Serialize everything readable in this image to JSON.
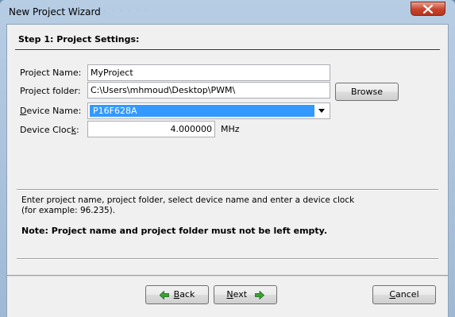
{
  "window": {
    "title": "New Project Wizard",
    "accent": "#c7432a"
  },
  "step": {
    "header": "Step 1: Project Settings:"
  },
  "form": {
    "project_name_label": "Project Name:",
    "project_name_value": "MyProject",
    "project_folder_label": "Project folder:",
    "project_folder_value": "C:\\Users\\mhmoud\\Desktop\\PWM\\",
    "browse_label": "Browse",
    "device_name_label_pre": "",
    "device_name_label_u": "D",
    "device_name_label_post": "evice Name:",
    "device_name_value": "P16F628A",
    "device_clock_label_pre": "Device Cloc",
    "device_clock_label_u": "k",
    "device_clock_label_post": ":",
    "device_clock_value": "4.000000",
    "device_clock_unit": "MHz"
  },
  "help": {
    "text_line1": "Enter project name, project folder, select device name and enter a device clock",
    "text_line2": "(for example: 96.235).",
    "note": "Note: Project name and project folder must not be left empty."
  },
  "nav": {
    "back_u": "B",
    "back_rest": "ack",
    "next_u": "N",
    "next_rest": "ext",
    "cancel_u": "C",
    "cancel_rest": "ancel",
    "arrow_color": "#3aa236"
  }
}
